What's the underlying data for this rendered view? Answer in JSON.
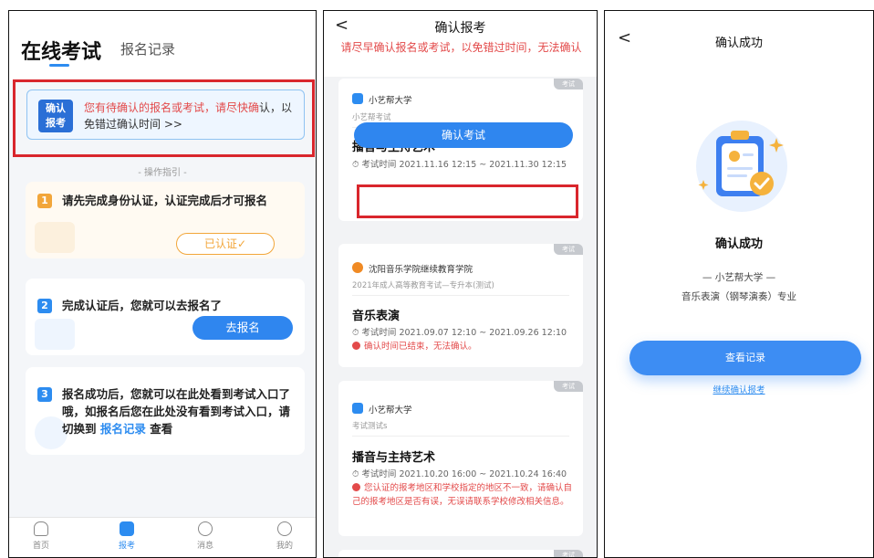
{
  "panel1": {
    "title": "在线考试",
    "tab_records": "报名记录",
    "notice": {
      "badge_line1": "确认",
      "badge_line2": "报考",
      "highlight": "您有待确认的报名或考试，请尽快确",
      "rest": "认，以免错过确认时间 >>"
    },
    "guide_title": "- 操作指引 -",
    "steps": [
      {
        "num": "1",
        "text": "请先完成身份认证，认证完成后才可报名",
        "button": "已认证✓"
      },
      {
        "num": "2",
        "text": "完成认证后，您就可以去报名了",
        "button": "去报名"
      },
      {
        "num": "3",
        "text_before": "报名成功后，您就可以在此处看到考试入口了哦，如报名后您在此处没有看到考试入口，请切换到 ",
        "link": "报名记录",
        "text_after": " 查看"
      }
    ],
    "tabbar": [
      "首页",
      "报考",
      "消息",
      "我的"
    ],
    "colors": {
      "accent": "#2d8cf0",
      "warning": "#e34a4a",
      "verified": "#f2a63a",
      "highlight_frame": "#d9262c"
    }
  },
  "panel2": {
    "back_icon": "<",
    "title": "确认报考",
    "warning": "请尽早确认报名或考试，以免错过时间，无法确认",
    "cards": [
      {
        "tag": "考试",
        "org": "小艺帮大学",
        "sub": "小艺帮考试",
        "exam": "播音与主持艺术",
        "time": "⏱ 考试时间  2021.11.16 12:15 ~ 2021.11.30 12:15",
        "button": "确认考试"
      },
      {
        "tag": "考试",
        "org": "沈阳音乐学院继续教育学院",
        "sub": "2021年成人高等教育考试—专升本(测试)",
        "exam": "音乐表演",
        "time": "⏱ 考试时间  2021.09.07 12:10 ~ 2021.09.26 12:10",
        "alert": "确认时间已结束，无法确认。"
      },
      {
        "tag": "考试",
        "org": "小艺帮大学",
        "sub": "考试测试s",
        "exam": "播音与主持艺术",
        "time": "⏱ 考试时间  2021.10.20 16:00 ~ 2021.10.24 16:40",
        "alert": "您认证的报考地区和学校指定的地区不一致，请确认自己的报考地区是否有误，无误请联系学校修改相关信息。"
      },
      {
        "tag": "考试"
      }
    ]
  },
  "panel3": {
    "back_icon": "<",
    "title": "确认成功",
    "heading": "确认成功",
    "org": "— 小艺帮大学 —",
    "major": "音乐表演（钢琴演奏）专业",
    "view_button": "查看记录",
    "continue_link": "继续确认报考"
  }
}
